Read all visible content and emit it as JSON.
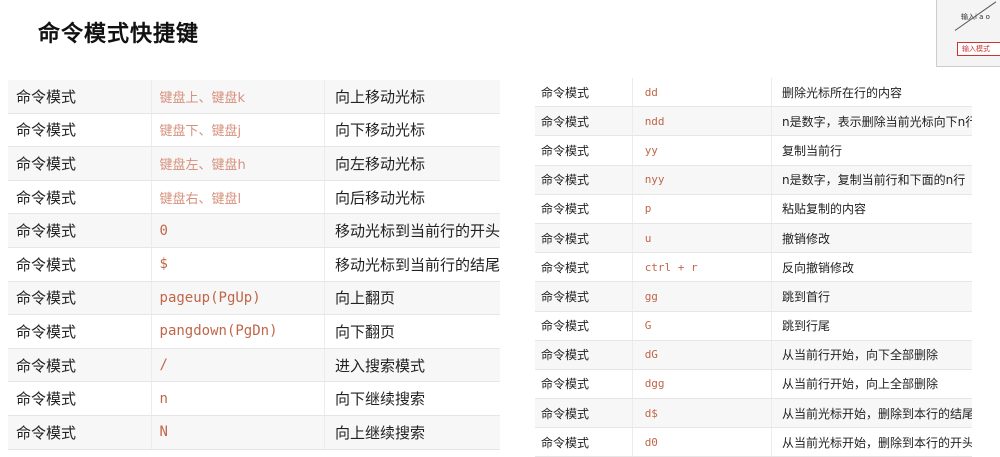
{
  "title": "命令模式快捷键",
  "thumbnail": {
    "top_text": "输入i a o",
    "box_text": "输入模式"
  },
  "left_table": [
    {
      "mode": "命令模式",
      "key": "键盘上、键盘k",
      "desc": "向上移动光标",
      "key_style": "light"
    },
    {
      "mode": "命令模式",
      "key": "键盘下、键盘j",
      "desc": "向下移动光标",
      "key_style": "light"
    },
    {
      "mode": "命令模式",
      "key": "键盘左、键盘h",
      "desc": "向左移动光标",
      "key_style": "light"
    },
    {
      "mode": "命令模式",
      "key": "键盘右、键盘l",
      "desc": "向后移动光标",
      "key_style": "light"
    },
    {
      "mode": "命令模式",
      "key": "0",
      "desc": "移动光标到当前行的开头",
      "key_style": "code"
    },
    {
      "mode": "命令模式",
      "key": "$",
      "desc": "移动光标到当前行的结尾",
      "key_style": "code"
    },
    {
      "mode": "命令模式",
      "key": "pageup(PgUp)",
      "desc": "向上翻页",
      "key_style": "code"
    },
    {
      "mode": "命令模式",
      "key": "pangdown(PgDn)",
      "desc": "向下翻页",
      "key_style": "code"
    },
    {
      "mode": "命令模式",
      "key": "/",
      "desc": "进入搜索模式",
      "key_style": "code"
    },
    {
      "mode": "命令模式",
      "key": "n",
      "desc": "向下继续搜索",
      "key_style": "code"
    },
    {
      "mode": "命令模式",
      "key": "N",
      "desc": "向上继续搜索",
      "key_style": "code"
    }
  ],
  "right_table": [
    {
      "mode": "命令模式",
      "key": "dd",
      "desc": "删除光标所在行的内容"
    },
    {
      "mode": "命令模式",
      "key": "ndd",
      "desc": "n是数字，表示删除当前光标向下n行"
    },
    {
      "mode": "命令模式",
      "key": "yy",
      "desc": "复制当前行"
    },
    {
      "mode": "命令模式",
      "key": "nyy",
      "desc": "n是数字，复制当前行和下面的n行"
    },
    {
      "mode": "命令模式",
      "key": "p",
      "desc": "粘贴复制的内容"
    },
    {
      "mode": "命令模式",
      "key": "u",
      "desc": "撤销修改"
    },
    {
      "mode": "命令模式",
      "key": "ctrl + r",
      "desc": "反向撤销修改"
    },
    {
      "mode": "命令模式",
      "key": "gg",
      "desc": "跳到首行"
    },
    {
      "mode": "命令模式",
      "key": "G",
      "desc": "跳到行尾"
    },
    {
      "mode": "命令模式",
      "key": "dG",
      "desc": "从当前行开始，向下全部删除"
    },
    {
      "mode": "命令模式",
      "key": "dgg",
      "desc": "从当前行开始，向上全部删除"
    },
    {
      "mode": "命令模式",
      "key": "d$",
      "desc": "从当前光标开始，删除到本行的结尾"
    },
    {
      "mode": "命令模式",
      "key": "d0",
      "desc": "从当前光标开始，删除到本行的开头"
    }
  ]
}
